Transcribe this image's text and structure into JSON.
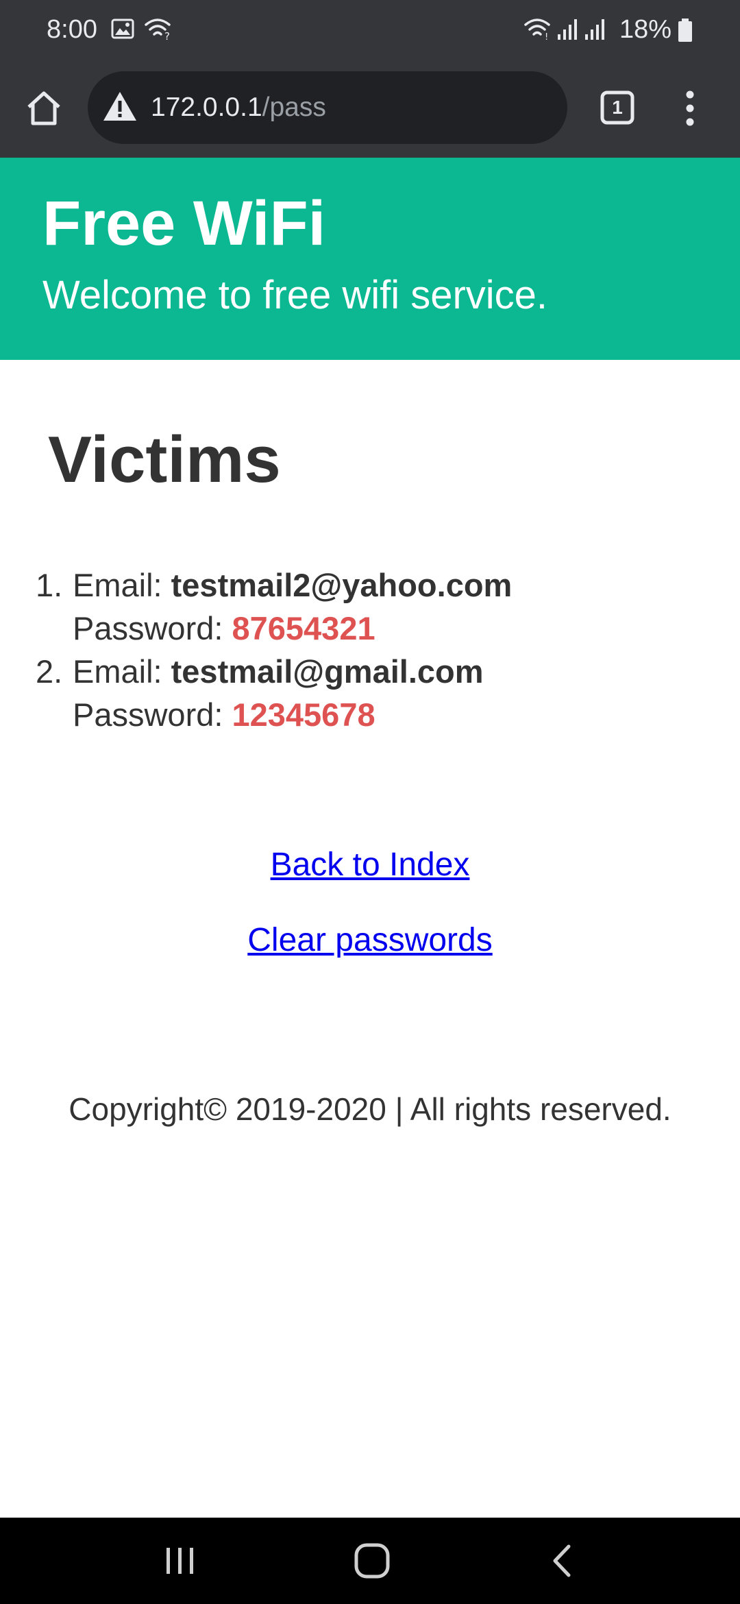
{
  "status_bar": {
    "time": "8:00",
    "battery": "18%",
    "icons": [
      "gallery-icon",
      "wifi-calling-icon",
      "wifi-icon",
      "signal-icon",
      "signal-icon",
      "battery-icon"
    ]
  },
  "browser": {
    "url_host": "172.0.0.1",
    "url_path": "/pass",
    "tab_count": "1",
    "icons": [
      "home-icon",
      "warning-icon",
      "tabs-icon",
      "menu-icon"
    ]
  },
  "header": {
    "title": "Free WiFi",
    "subtitle": "Welcome to free wifi service."
  },
  "main": {
    "heading": "Victims",
    "email_label": "Email: ",
    "password_label": "Password: ",
    "victims": [
      {
        "number": "1.",
        "email": "testmail2@yahoo.com",
        "password": "87654321"
      },
      {
        "number": "2.",
        "email": "testmail@gmail.com",
        "password": "12345678"
      }
    ],
    "back_link": "Back to Index",
    "clear_link": "Clear passwords"
  },
  "footer": {
    "copyright": "Copyright© 2019-2020 | All rights reserved."
  },
  "colors": {
    "header_bg": "#0bb892",
    "password_red": "#de5252",
    "link_blue": "#0000ee",
    "chrome_bg": "#35363a",
    "url_box_bg": "#202124"
  },
  "nav_bar": {
    "icons": [
      "recent-apps-icon",
      "home-nav-icon",
      "back-icon"
    ]
  }
}
